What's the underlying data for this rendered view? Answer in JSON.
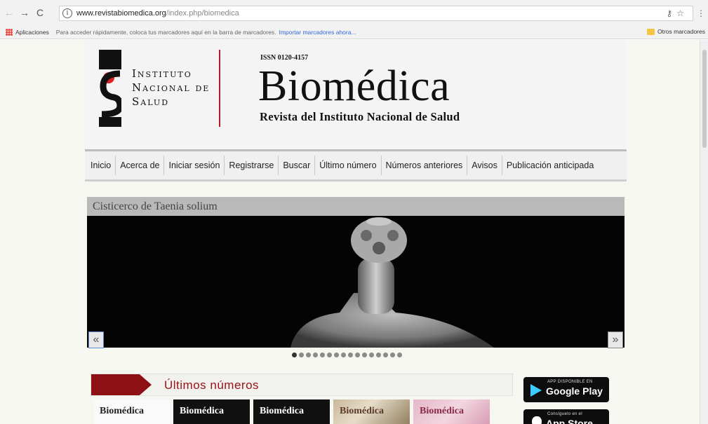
{
  "browser": {
    "url_host": "www.revistabiomedica.org",
    "url_path": "/index.php/biomedica",
    "bookmarks_apps": "Aplicaciones",
    "bookmarks_hint": "Para acceder rápidamente, coloca tus marcadores aquí en la barra de marcadores.",
    "bookmarks_import": "Importar marcadores ahora...",
    "bookmarks_other": "Otros marcadores"
  },
  "header": {
    "institute_line1": "Instituto",
    "institute_line2": "Nacional de",
    "institute_line3": "Salud",
    "issn": "ISSN 0120-4157",
    "journal_title": "Biomédica",
    "journal_subtitle": "Revista del Instituto Nacional de Salud"
  },
  "nav": {
    "items": [
      "Inicio",
      "Acerca de",
      "Iniciar sesión",
      "Registrarse",
      "Buscar",
      "Último número",
      "Números anteriores",
      "Avisos",
      "Publicación anticipada"
    ]
  },
  "slider": {
    "caption": "Cisticerco de Taenia solium",
    "prev_symbol": "«",
    "next_symbol": "»",
    "dot_count": 16,
    "active_dot": 0
  },
  "issues": {
    "section_title": "Últimos números",
    "cover_titles": [
      "Biomédica",
      "Biomédica",
      "Biomédica",
      "Biomédica",
      "Biomédica"
    ]
  },
  "stores": {
    "google_small": "APP DISPONIBLE EN",
    "google_big": "Google Play",
    "apple_small": "Consíguelo en el",
    "apple_big": "App Store"
  }
}
